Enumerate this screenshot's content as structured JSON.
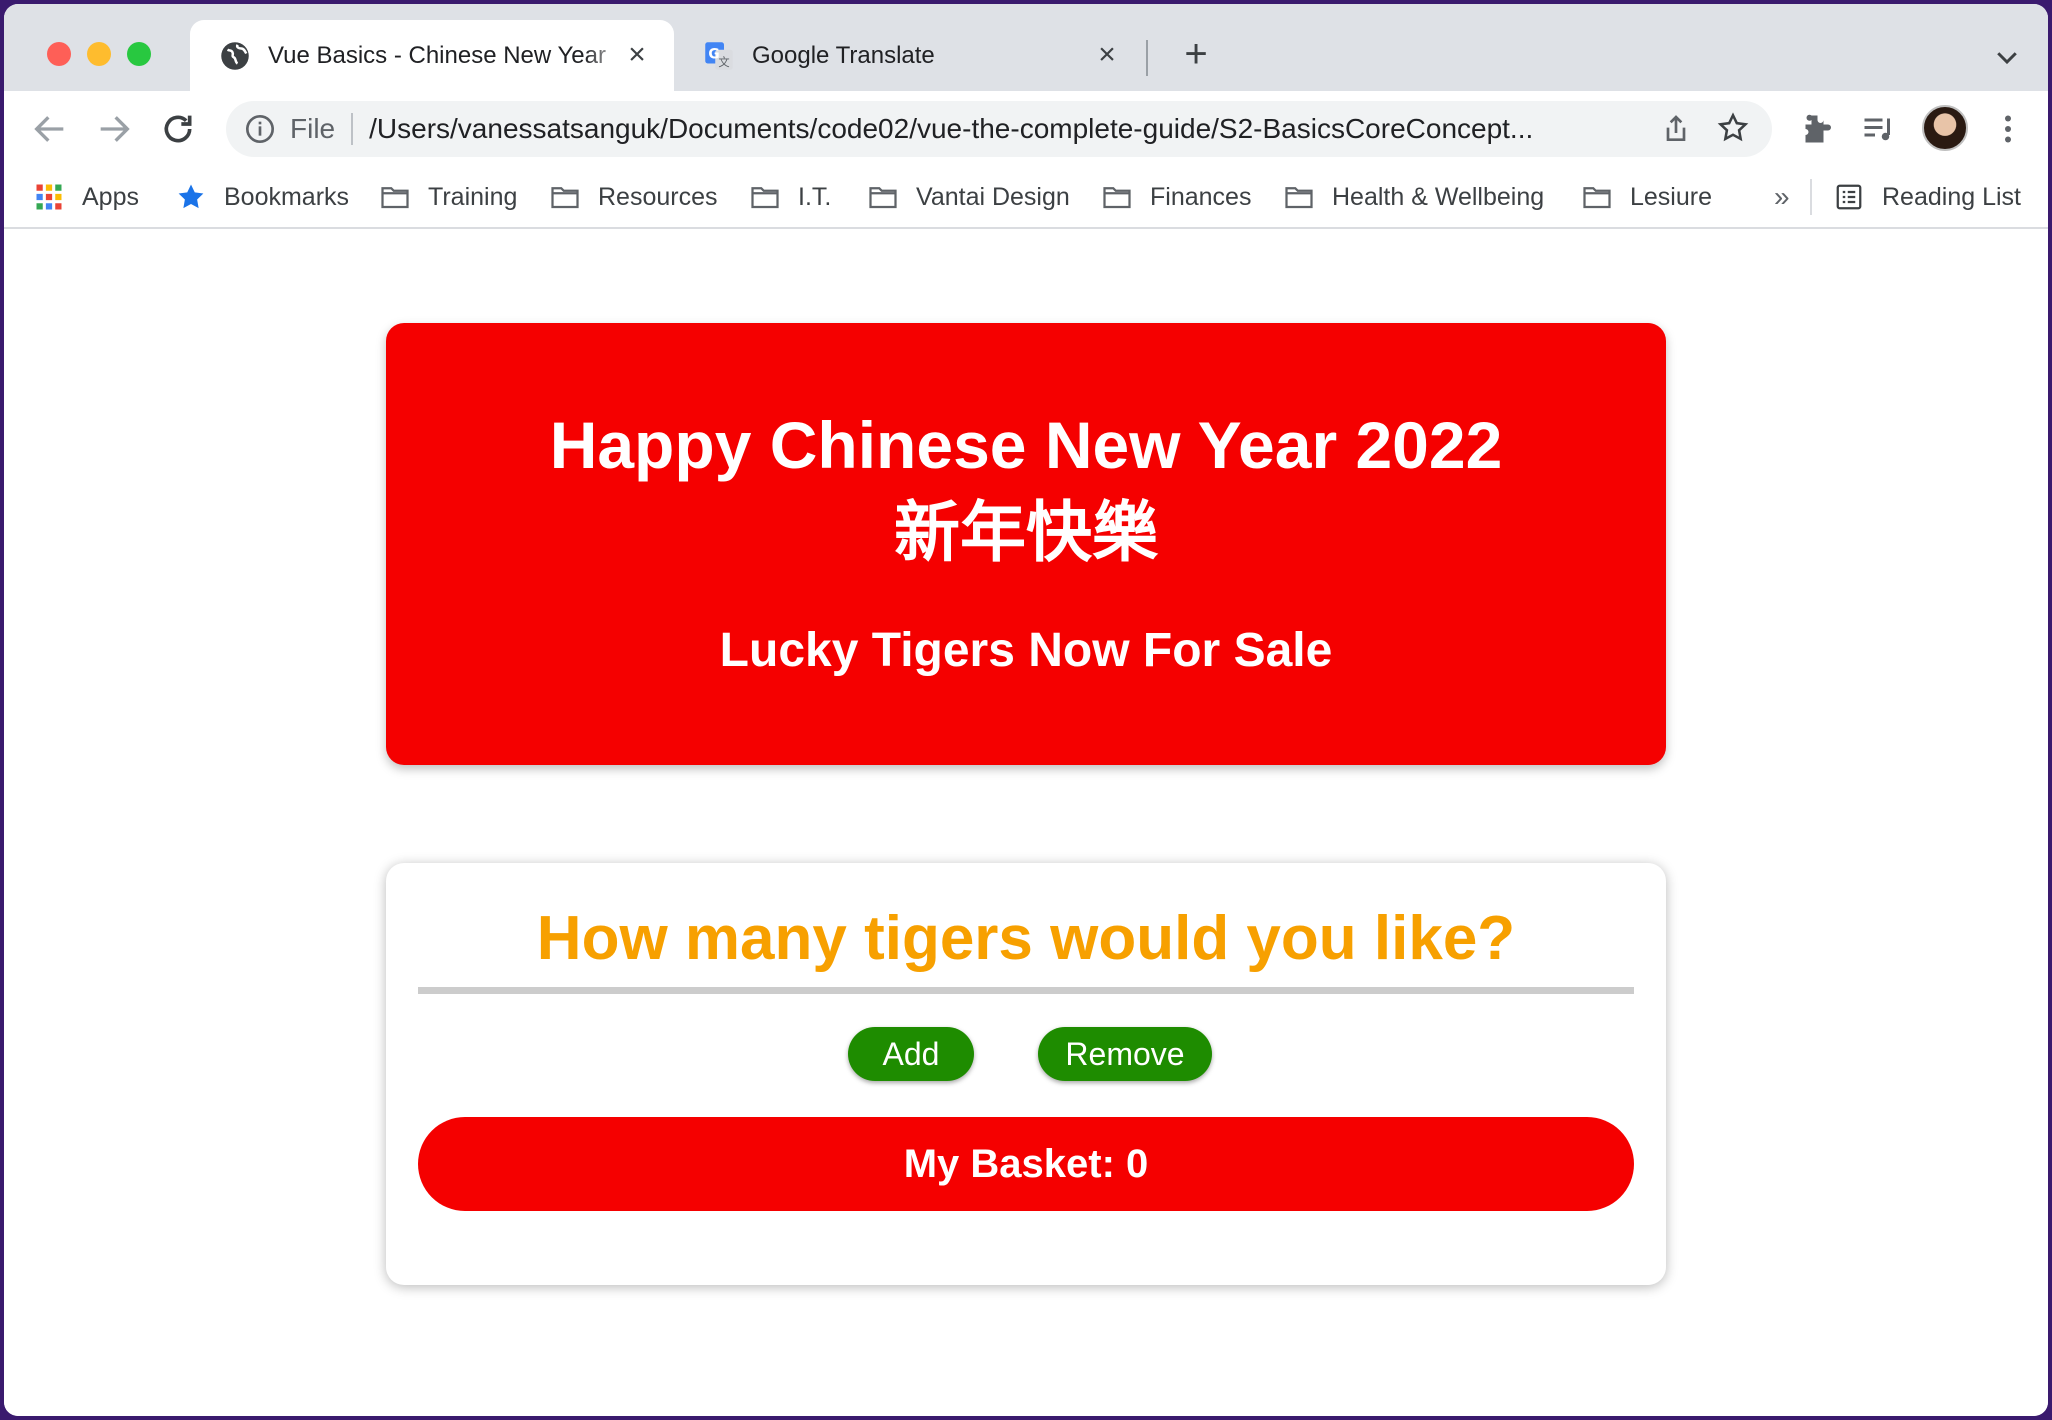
{
  "browser": {
    "tabs": [
      {
        "title": "Vue Basics - Chinese New Year",
        "active": true
      },
      {
        "title": "Google Translate",
        "active": false
      }
    ],
    "address_scheme": "File",
    "url": "/Users/vanessatsanguk/Documents/code02/vue-the-complete-guide/S2-BasicsCoreConcept..."
  },
  "bookmarks": {
    "apps": "Apps",
    "bookmarks": "Bookmarks",
    "folders": [
      "Training",
      "Resources",
      "I.T.",
      "Vantai Design",
      "Finances",
      "Health & Wellbeing",
      "Lesiure"
    ],
    "more": "»",
    "reading_list": "Reading List"
  },
  "hero": {
    "title": "Happy Chinese New Year 2022",
    "chinese": "新年快樂",
    "subtitle": "Lucky Tigers Now For Sale"
  },
  "card": {
    "question": "How many tigers would you like?",
    "add_label": "Add",
    "remove_label": "Remove",
    "basket_label": "My Basket: 0"
  },
  "colors": {
    "accent_red": "#f50000",
    "button_green": "#1e8c00",
    "heading_orange": "#f7a000"
  }
}
